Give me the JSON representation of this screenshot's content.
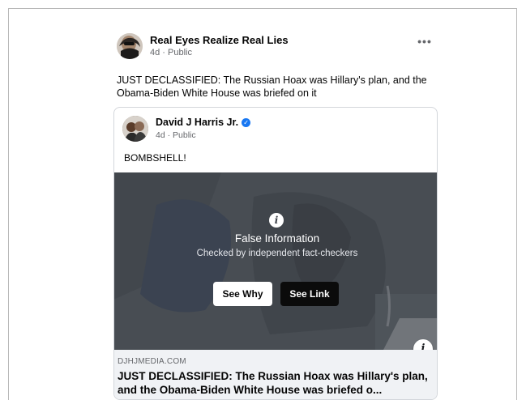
{
  "post": {
    "author": "Real Eyes Realize Real Lies",
    "meta": "4d · Public",
    "more_label": "•••",
    "text": "JUST DECLASSIFIED: The Russian Hoax was Hillary's plan, and the Obama-Biden White House was briefed on it"
  },
  "shared": {
    "author": "David J Harris Jr.",
    "verified_glyph": "✓",
    "meta": "4d · Public",
    "text": "BOMBSHELL!"
  },
  "warning": {
    "icon": "i",
    "title": "False Information",
    "subtitle": "Checked by independent fact-checkers",
    "see_why": "See Why",
    "see_link": "See Link",
    "info_icon": "i"
  },
  "link": {
    "domain": "DJHJMEDIA.COM",
    "title": "JUST DECLASSIFIED: The Russian Hoax was Hillary's plan, and the Obama-Biden White House was briefed o..."
  },
  "colors": {
    "accent": "#1877f2",
    "overlay": "#464a50",
    "footer_bg": "#f0f2f5"
  }
}
